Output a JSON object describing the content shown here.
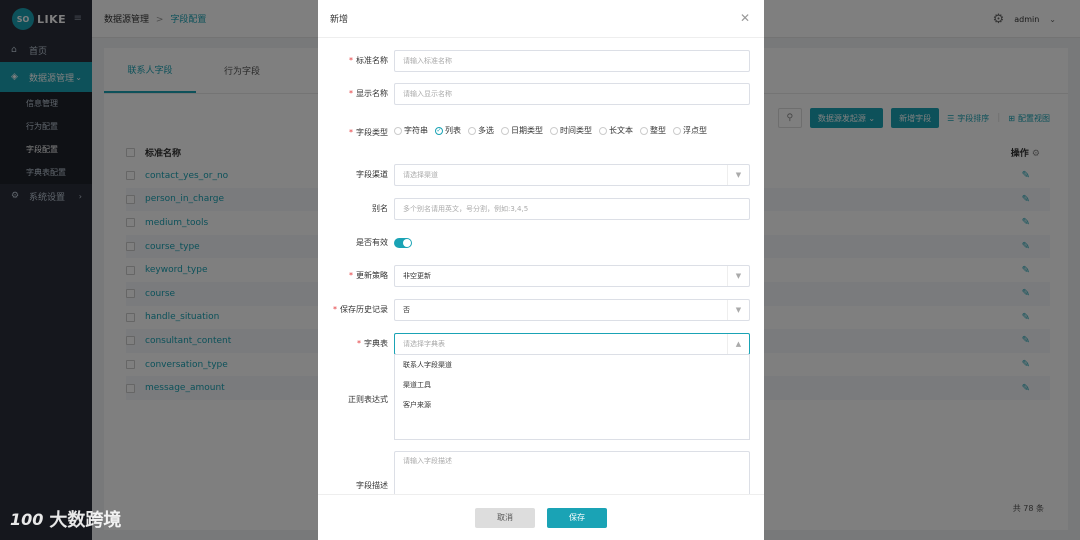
{
  "app": {
    "logo_mark": "SO",
    "logo_text": "LIKE"
  },
  "sidebar": {
    "items": [
      {
        "label": "首页"
      },
      {
        "label": "数据源管理"
      },
      {
        "label": "系统设置"
      }
    ],
    "sub_items": [
      {
        "label": "信息管理"
      },
      {
        "label": "行为配置"
      },
      {
        "label": "字段配置"
      },
      {
        "label": "字典表配置"
      }
    ]
  },
  "breadcrumb": {
    "parent": "数据源管理",
    "separator": ">",
    "current": "字段配置"
  },
  "user": {
    "name": "admin"
  },
  "tabs": [
    {
      "label": "联系人字段"
    },
    {
      "label": "行为字段"
    }
  ],
  "toolbar": {
    "import_label": "数据源发起源",
    "add_label": "新增字段",
    "sort_label": "字段排序",
    "config_label": "配置视图"
  },
  "table": {
    "col_name": "标准名称",
    "col_op": "操作",
    "rows": [
      "contact_yes_or_no",
      "person_in_charge",
      "medium_tools",
      "course_type",
      "keyword_type",
      "course",
      "handle_situation",
      "consultant_content",
      "conversation_type",
      "message_amount"
    ],
    "total": "共 78 条"
  },
  "modal": {
    "title": "新增",
    "fields": {
      "std_name": {
        "label": "标准名称",
        "placeholder": "请输入标准名称"
      },
      "display_name": {
        "label": "显示名称",
        "placeholder": "请输入显示名称"
      },
      "field_type": {
        "label": "字段类型",
        "options": [
          "字符串",
          "列表",
          "多选",
          "日期类型",
          "时间类型",
          "长文本",
          "整型",
          "浮点型"
        ],
        "selected": "列表"
      },
      "channel": {
        "label": "字段渠道",
        "placeholder": "请选择渠道"
      },
      "alias": {
        "label": "别名",
        "placeholder": "多个别名请用英文，号分割，例如:3,4,5"
      },
      "valid": {
        "label": "是否有效"
      },
      "update_strategy": {
        "label": "更新策略",
        "value": "非空更新"
      },
      "keep_history": {
        "label": "保存历史记录",
        "value": "否"
      },
      "dict": {
        "label": "字典表",
        "placeholder": "请选择字典表",
        "options": [
          "联系人字段渠道",
          "渠道工具",
          "客户来源"
        ]
      },
      "regex": {
        "label": "正则表达式"
      },
      "desc": {
        "label": "字段描述",
        "placeholder": "请输入字段描述"
      }
    },
    "cancel": "取消",
    "save": "保存"
  },
  "watermark": {
    "logo": "100",
    "text": "大数跨境"
  }
}
